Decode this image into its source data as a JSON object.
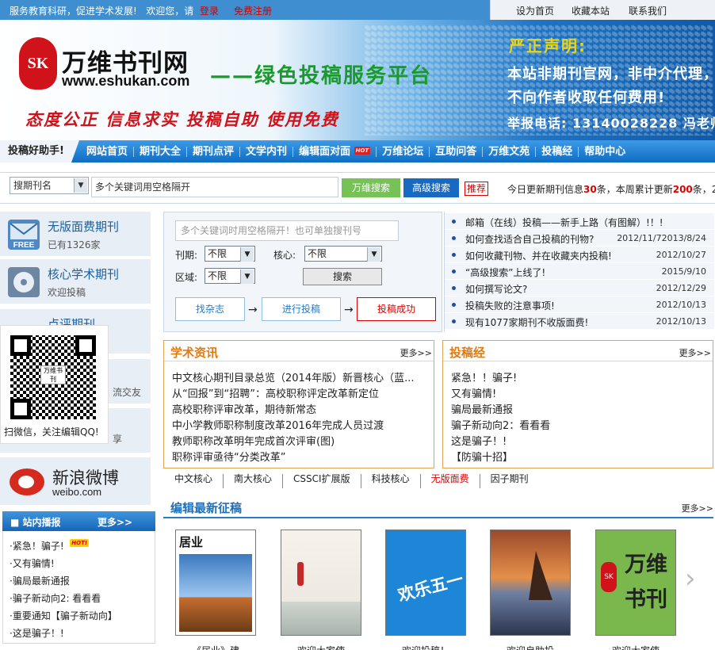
{
  "topbar": {
    "slogan": "服务教育科研，促进学术发展!",
    "welcome": "欢迎您，请",
    "login": "登录",
    "register": "免费注册",
    "set_home": "设为首页",
    "bookmark": "收藏本站",
    "contact": "联系我们"
  },
  "banner": {
    "logo_mark": "SK",
    "logo_text": "万维书刊网",
    "logo_url": "www.eshukan.com",
    "slogan": "——绿色投稿服务平台",
    "motto": "态度公正  信息求实  投稿自助  使用免费",
    "notice_title": "严正声明:",
    "notice_line1": "本站非期刊官网，非中介代理，",
    "notice_line2": "不向作者收取任何费用!",
    "notice_line3": "举报电话: 13140028228 冯老师"
  },
  "nav": {
    "lead": "投稿好助手!",
    "items": [
      "网站首页",
      "期刊大全",
      "期刊点评",
      "文学内刊",
      "编辑面对面",
      "万维论坛",
      "互助问答",
      "万维文苑",
      "投稿经",
      "帮助中心"
    ],
    "hot_label": "HOT"
  },
  "search": {
    "type_value": "搜期刊名",
    "placeholder": "多个关键词用空格隔开",
    "btn_search": "万维搜索",
    "btn_advanced": "高级搜索",
    "recommend": "推荐",
    "today_prefix": "今日更新期刊信息",
    "today_count": "30",
    "today_mid": "条，本周累计更新",
    "week_count": "200",
    "today_suffix": "条，2"
  },
  "left": {
    "cards": [
      {
        "title": "无版面费期刊",
        "sub": "已有1326家"
      },
      {
        "title": "核心学术期刊",
        "sub": "欢迎投稿"
      },
      {
        "title": "点评期刊",
        "sub": ""
      },
      {
        "title": "",
        "sub": "流交友"
      },
      {
        "title": "",
        "sub": "享"
      }
    ],
    "qr_caption": "扫微信，关注编辑QQ!",
    "qr_inner": "万维书刊",
    "weibo_title": "新浪微博",
    "weibo_url": "weibo.com"
  },
  "broadcast": {
    "title": "站内播报",
    "more": "更多>>",
    "items": [
      "·紧急！骗子!",
      "·又有骗情!",
      "·骗局最新通报",
      "·骗子新动向2: 看看看",
      "·重要通知【骗子新动向】",
      "·这是骗子！!"
    ],
    "hot": "HOT!"
  },
  "query": {
    "placeholder": "多个关键词时用空格隔开！也可单独搜刊号",
    "cycle_label": "刊期:",
    "cycle_value": "不限",
    "core_label": "核心:",
    "core_value": "不限",
    "region_label": "区域:",
    "region_value": "不限",
    "btn": "搜索",
    "step1": "找杂志",
    "step2": "进行投稿",
    "step3": "投稿成功",
    "arrow": "→"
  },
  "news": [
    {
      "text": "邮箱（在线）投稿——新手上路（有图解）!！!",
      "date": ""
    },
    {
      "text": "如何查找适合自己投稿的刊物?",
      "date": "2012/11/72013/8/24"
    },
    {
      "text": "如何收藏刊物、并在收藏夹内投稿!",
      "date": "2012/10/27"
    },
    {
      "text": "“高级搜索”上线了!",
      "date": "2015/9/10"
    },
    {
      "text": "如何撰写论文?",
      "date": "2012/12/29"
    },
    {
      "text": "投稿失败的注意事项!",
      "date": "2012/10/13"
    },
    {
      "text": "现有1077家期刊不收版面费!",
      "date": "2012/10/13"
    }
  ],
  "academic": {
    "title": "学术资讯",
    "more": "更多>>",
    "items": [
      "中文核心期刊目录总览（2014年版）新晋核心（蓝...",
      "从“回报”到“招聘”：高校职称评定改革新定位",
      "高校职称评审改革，期待新常态",
      "中小学教师职称制度改革2016年完成人员过渡",
      "教师职称改革明年完成首次评审(图)",
      "职称评审亟待“分类改革”"
    ]
  },
  "guide": {
    "title": "投稿经",
    "more": "更多>>",
    "items": [
      "紧急！！骗子!",
      "又有骗情!",
      "骗局最新通报",
      "骗子新动向2：看看看",
      "这是骗子！!",
      "【防骗十招】"
    ]
  },
  "categories": [
    "中文核心",
    "南大核心",
    "CSSCI扩展版",
    "科技核心",
    "无版面费",
    "因子期刊"
  ],
  "recent": {
    "title": "编辑最新征稿",
    "more": "更多>>",
    "covers": [
      {
        "caption": "《居业》建",
        "label": "居业"
      },
      {
        "caption": "欢迎大家使",
        "label": ""
      },
      {
        "caption": "欢迎投稿！",
        "label": "欢乐五一"
      },
      {
        "caption": "欢迎自助投",
        "label": ""
      },
      {
        "caption": "欢迎大家使",
        "label": "万维书刊"
      }
    ]
  },
  "colors": {
    "nav_blue": "#1266bb",
    "accent_red": "#d00000",
    "orange": "#e27a12",
    "green": "#1a9a2c"
  }
}
